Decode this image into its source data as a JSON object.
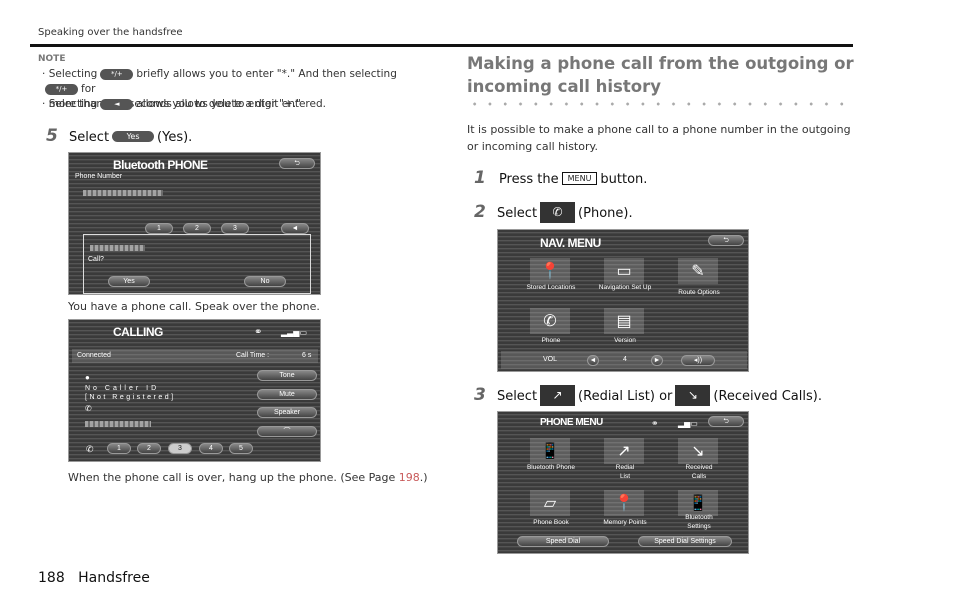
{
  "header": {
    "section": "Speaking over the handsfree"
  },
  "note": {
    "title": "NOTE",
    "item1_a": "Selecting",
    "item1_b": "briefly allows you to enter \"*.\" And then selecting",
    "item1_c": "for",
    "item1_d": "more than two seconds allows you to enter \"+.\"",
    "star_button": "*/+",
    "delete_button": "◄",
    "item2_a": "Selecting",
    "item2_b": "allows you to delete a digit entered."
  },
  "left_steps": {
    "step5_num": "5",
    "step5_a": "Select",
    "yes_chip": "Yes",
    "step5_b": "(Yes).",
    "caption1": "You have a phone call. Speak over the phone.",
    "caption2_a": "When the phone call is over, hang up the phone. (See Page ",
    "caption2_page": "198",
    "caption2_b": ".)"
  },
  "screen1": {
    "title": "Bluetooth PHONE",
    "back": "⮌",
    "label": "Phone Number",
    "keys": [
      "1",
      "2",
      "3",
      "◄"
    ],
    "dialog_text": "Call?",
    "yes": "Yes",
    "no": "No"
  },
  "screen2": {
    "title": "CALLING",
    "status": "Connected",
    "call_time_label": "Call Time :",
    "call_time": "6 s",
    "caller": "No Caller ID",
    "registered": "[Not Registered]",
    "buttons": [
      "Tone",
      "Mute",
      "Speaker"
    ],
    "keys": [
      "1",
      "2",
      "3",
      "4",
      "5"
    ]
  },
  "right": {
    "heading": "Making a phone call from the outgoing or incoming call history",
    "intro": "It is possible to make a phone call to a phone number in the outgoing or incoming call history.",
    "step1_num": "1",
    "step1_a": "Press the",
    "menu_key": "MENU",
    "step1_b": "button.",
    "step2_num": "2",
    "step2_a": "Select",
    "step2_b": "(Phone).",
    "step3_num": "3",
    "step3_a": "Select",
    "step3_b": "(Redial List) or",
    "step3_c": "(Received Calls)."
  },
  "screen3": {
    "title": "NAV. MENU",
    "back": "⮌",
    "items": [
      "Stored Locations",
      "Navigation Set Up",
      "Route Options",
      "Phone",
      "Version"
    ],
    "vol_label": "VOL",
    "vol_value": "4"
  },
  "screen4": {
    "title": "PHONE MENU",
    "back": "⮌",
    "items": [
      "Bluetooth Phone",
      "Redial List",
      "Received Calls",
      "Phone Book",
      "Memory Points",
      "Bluetooth Settings"
    ],
    "speed_dial": "Speed Dial",
    "speed_dial_settings": "Speed Dial Settings"
  },
  "footer": {
    "page": "188",
    "section": "Handsfree"
  }
}
